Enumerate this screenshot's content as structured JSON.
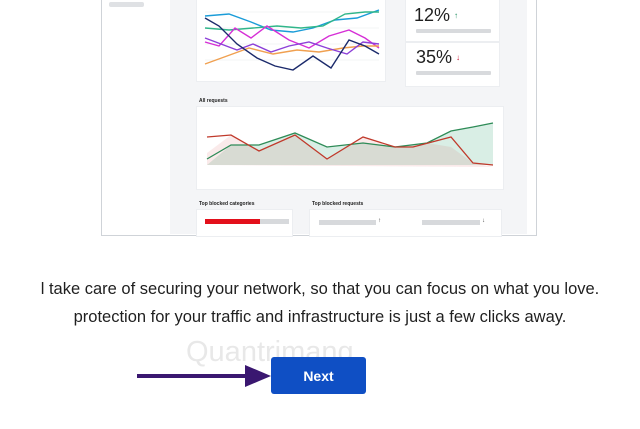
{
  "illustration": {
    "stats": [
      {
        "value": "12%",
        "arrow": "↑",
        "arrow_color": "#1f8f60"
      },
      {
        "value": "35%",
        "arrow": "↓",
        "arrow_color": "#c8102e"
      }
    ],
    "all_requests_label": "All requests",
    "top_blocked_categories_label": "Top blocked categories",
    "top_blocked_requests_label": "Top blocked requests",
    "requests_arrows": [
      "↑",
      "↓"
    ],
    "category_bar_fill": 0.65,
    "category_bar_color": "#e3101b",
    "line_colors": [
      "#1a9cd8",
      "#30b68a",
      "#d62fd6",
      "#f0a050",
      "#1b2a6b",
      "#8c3fd8"
    ],
    "area_colors": {
      "green": "#2e8b57",
      "red": "#c0392b"
    }
  },
  "tagline": {
    "line1": "l take care of securing your network, so that you can focus on what you love.",
    "line2": "protection for your traffic and infrastructure is just a few clicks away."
  },
  "next_button": {
    "label": "Next",
    "color": "#0f4fc4"
  },
  "pointer_arrow_color": "#3a1770",
  "watermark": "Quantrimang"
}
